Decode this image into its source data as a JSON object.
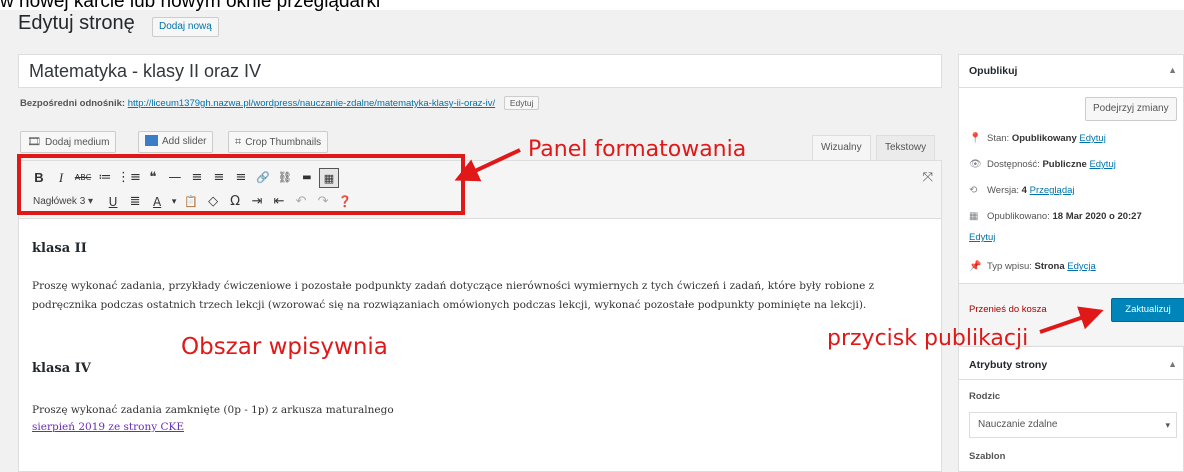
{
  "caption": "w nowej karcie lub nowym oknie przeglądarki",
  "header": {
    "title": "Edytuj stronę",
    "add_new": "Dodaj nową"
  },
  "post": {
    "title": "Matematyka - klasy II oraz IV",
    "permalink_label": "Bezpośredni odnośnik:",
    "permalink_url": "http://liceum1379gh.nazwa.pl/wordpress/nauczanie-zdalne/matematyka-klasy-ii-oraz-iv/",
    "permalink_edit": "Edytuj"
  },
  "media_buttons": {
    "add_media": "Dodaj medium",
    "add_slider": "Add slider",
    "crop": "Crop Thumbnails"
  },
  "editor_tabs": {
    "visual": "Wizualny",
    "text": "Tekstowy"
  },
  "toolbar": {
    "row1": [
      "B",
      "I",
      "ABC",
      "≔",
      "⋮≡",
      "❝",
      "—",
      "≡",
      "≡",
      "≡",
      "🔗",
      "⛓",
      "▬",
      "▦"
    ],
    "row2_format": "Nagłówek 3",
    "row2_caret": "▾",
    "row2": [
      "U",
      "≣",
      "A",
      "▾",
      "📋",
      "◇",
      "Ω",
      "⇥",
      "⇤",
      "↶",
      "↷",
      "❓"
    ],
    "expand": "⤧"
  },
  "content": {
    "heading_1": "klasa II",
    "paragraph_1": "Proszę wykonać zadania, przykłady ćwiczeniowe i pozostałe podpunkty zadań dotyczące nierówności wymiernych z tych ćwiczeń i zadań, które były robione z podręcznika podczas ostatnich trzech lekcji (wzorować się na rozwiązaniach omówionych podczas lekcji, wykonać pozostałe podpunkty pominięte na lekcji).",
    "heading_2": "klasa IV",
    "paragraph_2": "Proszę wykonać zadania zamknięte (0p - 1p) z arkusza maturalnego",
    "link_text": "sierpień 2019 ze strony CKE"
  },
  "annotations": {
    "panel": "Panel formatowania",
    "area": "Obszar wpisywnia",
    "button": "przycisk publikacji",
    "color": "#e01818"
  },
  "publish": {
    "title": "Opublikuj",
    "preview": "Podejrzyj zmiany",
    "status_label": "Stan:",
    "status_value": "Opublikowany",
    "status_edit": "Edytuj",
    "visibility_label": "Dostępność:",
    "visibility_value": "Publiczne",
    "visibility_edit": "Edytuj",
    "revisions_label": "Wersja:",
    "revisions_value": "4",
    "revisions_link": "Przeglądaj",
    "published_label": "Opublikowano:",
    "published_value": "18 Mar 2020 o 20:27",
    "published_edit": "Edytuj",
    "type_label": "Typ wpisu:",
    "type_value": "Strona",
    "type_edit": "Edycja",
    "trash": "Przenieś do kosza",
    "update": "Zaktualizuj"
  },
  "attributes": {
    "title": "Atrybuty strony",
    "parent_label": "Rodzic",
    "parent_value": "Nauczanie zdalne",
    "template_label": "Szablon"
  },
  "colors": {
    "primary_button": "#0085ba",
    "link": "#0073aa",
    "visited_link": "#6a2db3",
    "annotation_red": "#e01818"
  }
}
